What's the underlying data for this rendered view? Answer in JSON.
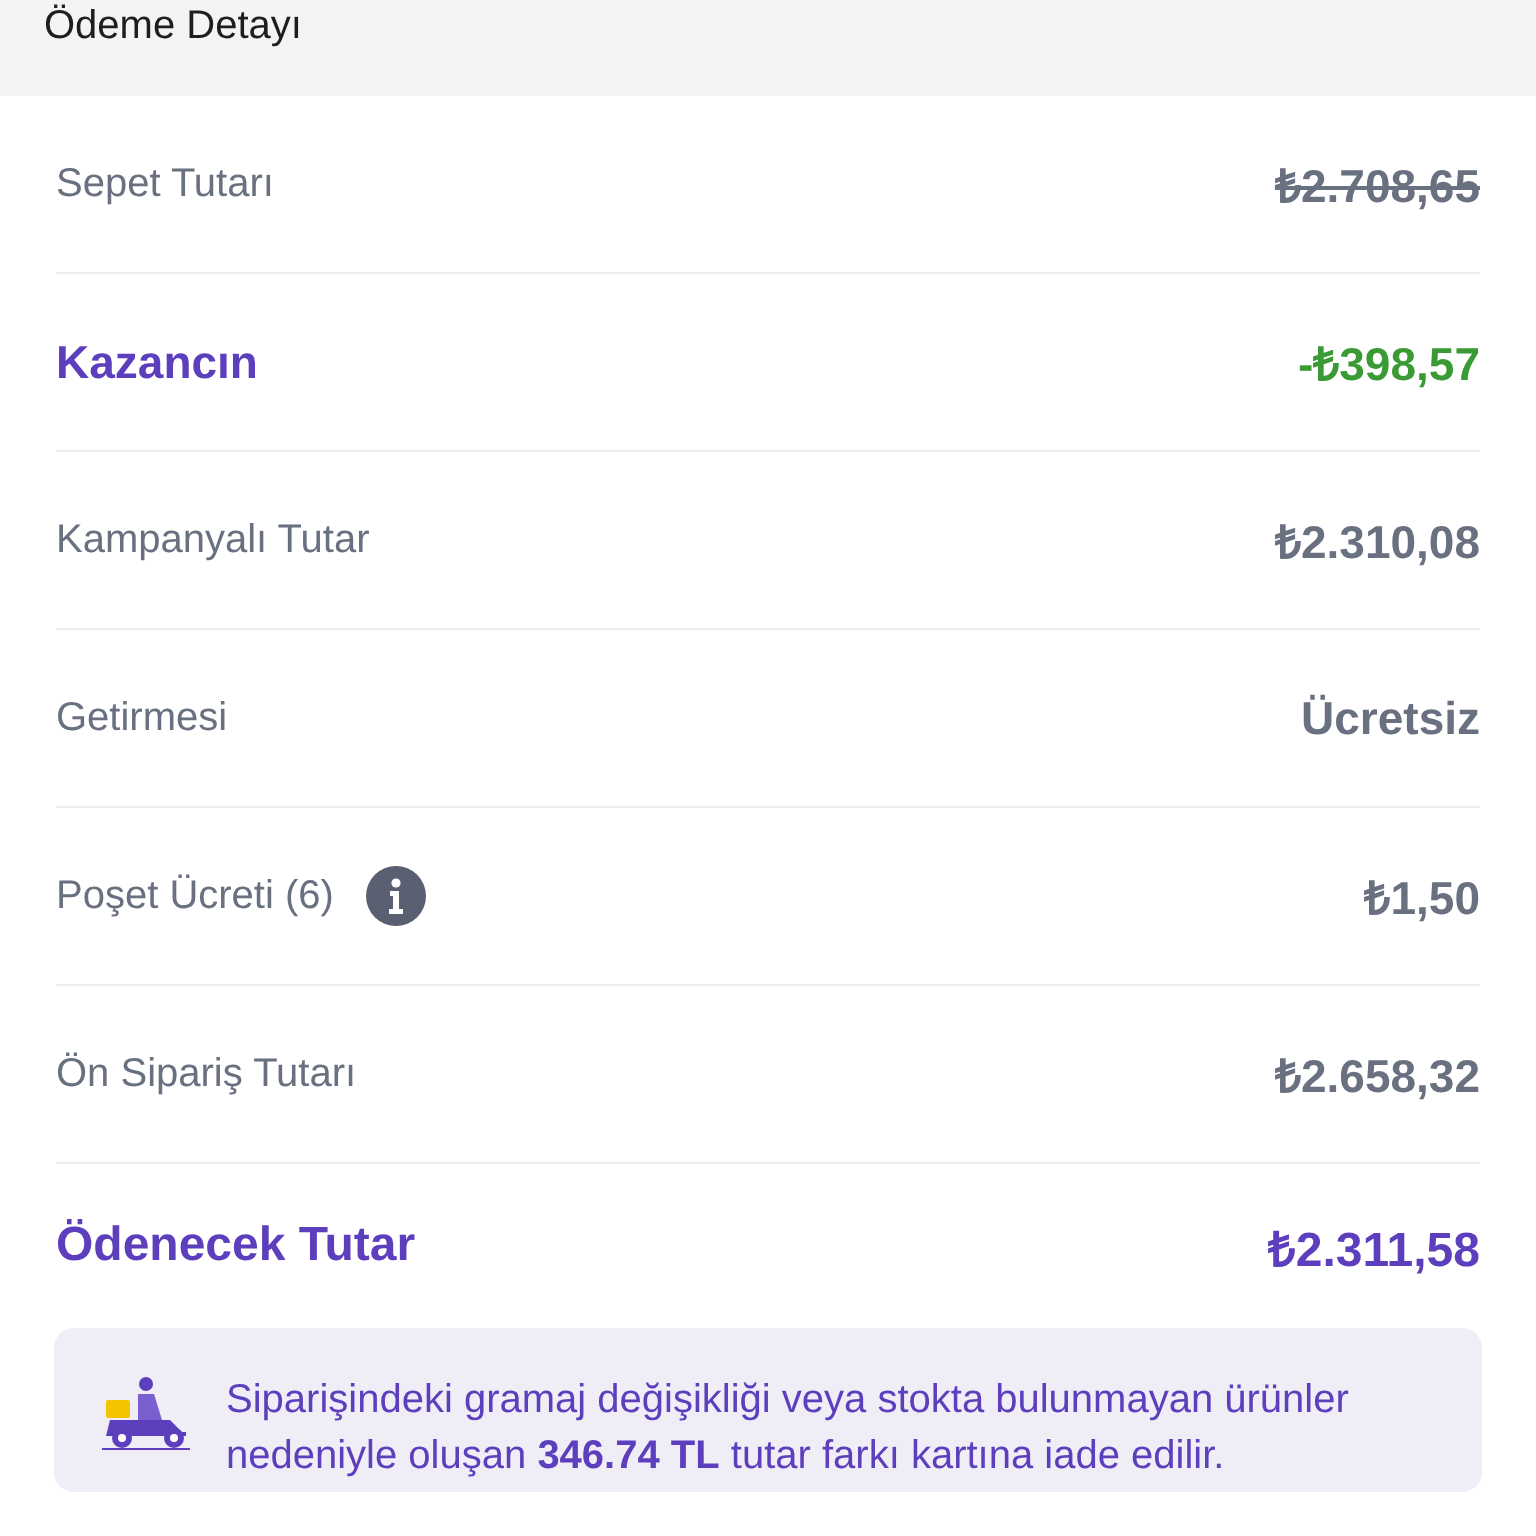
{
  "header": {
    "title": "Ödeme Detayı"
  },
  "rows": [
    {
      "label": "Sepet Tutarı",
      "value": "₺2.708,65",
      "kind": "strikethrough",
      "info": false
    },
    {
      "label": "Kazancın",
      "value": "-₺398,57",
      "kind": "discount",
      "info": false
    },
    {
      "label": "Kampanyalı Tutar",
      "value": "₺2.310,08",
      "kind": "plain",
      "info": false
    },
    {
      "label": "Getirmesi",
      "value": "Ücretsiz",
      "kind": "plain",
      "info": false
    },
    {
      "label": "Poşet Ücreti (6)",
      "value": "₺1,50",
      "kind": "plain",
      "info": true
    },
    {
      "label": "Ön Sipariş Tutarı",
      "value": "₺2.658,32",
      "kind": "plain",
      "info": false
    },
    {
      "label": "Ödenecek Tutar",
      "value": "₺2.311,58",
      "kind": "total",
      "info": false
    }
  ],
  "notice": {
    "text": "Siparişindeki gramaj değişikliği veya stokta bulunmayan ürünler nedeniyle oluşan  **346.74 TL**  tutar farkı kartına iade edilir."
  }
}
